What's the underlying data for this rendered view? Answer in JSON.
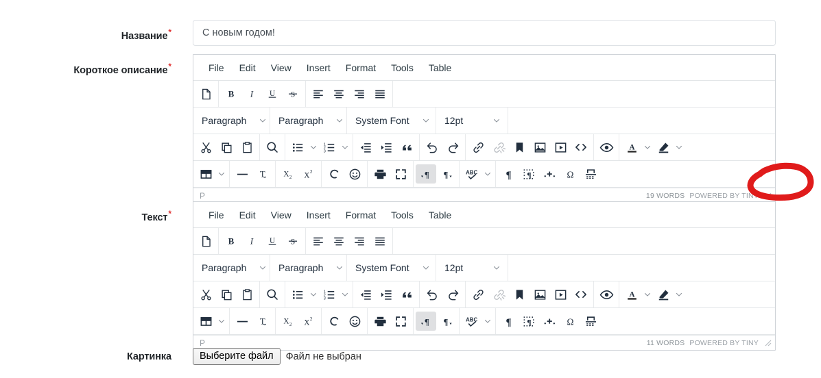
{
  "form": {
    "fields": [
      {
        "label": "Название",
        "required": true
      },
      {
        "label": "Короткое описание",
        "required": true
      },
      {
        "label": "Текст",
        "required": true
      },
      {
        "label": "Картинка",
        "required": false
      }
    ],
    "title_value": "С новым годом!",
    "title_placeholder": "",
    "file_button_label": "Выберите файл",
    "file_status_text": "Файл не выбран"
  },
  "editor": {
    "menu": [
      "File",
      "Edit",
      "View",
      "Insert",
      "Format",
      "Tools",
      "Table"
    ],
    "selects": {
      "blocks": "Paragraph",
      "styles": "Paragraph",
      "fontfamily": "System Font",
      "fontsize": "12pt"
    },
    "row1_icons": [
      "new-document-icon",
      "bold-icon",
      "italic-icon",
      "underline-icon",
      "strikethrough-icon",
      "align-left-icon",
      "align-center-icon",
      "align-right-icon",
      "align-justify-icon"
    ],
    "row3_icons": [
      "cut-icon",
      "copy-icon",
      "paste-icon",
      "search-replace-icon",
      "bullet-list-icon",
      "numbered-list-icon",
      "outdent-icon",
      "indent-icon",
      "blockquote-icon",
      "undo-icon",
      "redo-icon",
      "link-icon",
      "unlink-icon",
      "bookmark-icon",
      "image-icon",
      "media-icon",
      "source-code-icon",
      "preview-icon",
      "text-color-icon",
      "highlight-color-icon"
    ],
    "row4_icons": [
      "table-icon",
      "horizontal-rule-icon",
      "clear-formatting-icon",
      "subscript-icon",
      "superscript-icon",
      "special-character-icon",
      "emoticon-icon",
      "print-icon",
      "fullscreen-icon",
      "ltr-icon",
      "rtl-icon",
      "spellcheck-icon",
      "visual-blocks-icon",
      "invisible-characters-icon",
      "nonbreaking-space-icon",
      "charmap-icon",
      "page-break-icon"
    ],
    "statusbar": {
      "element_path": "P",
      "brand": "POWERED BY TINY",
      "resize_handle": "resize-handle-icon"
    }
  },
  "editors": [
    {
      "name": "short-description-editor",
      "words": "19 WORDS"
    },
    {
      "name": "text-editor",
      "words": "11 WORDS"
    }
  ],
  "annotation": {
    "shape": "hand-drawn-red-ellipse",
    "color": "#e01b1b",
    "target": "POWERED BY TINY"
  },
  "colors": {
    "required_star": "#e03131",
    "border": "#cfd3d8",
    "text": "#212529",
    "muted": "#9aa0a6",
    "active_button_bg": "#dfe0e2"
  }
}
